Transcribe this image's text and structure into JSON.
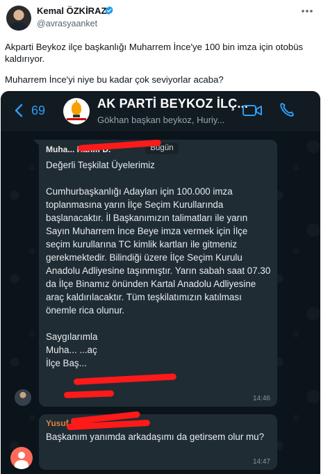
{
  "tweet": {
    "display_name": "Kemal ÖZKİRAZ",
    "handle": "@avrasyaanket",
    "text_line_1": "Akparti Beykoz ilçe başkanlığı Muharrem İnce'ye 100 bin imza için otobüs kaldırıyor.",
    "text_line_2": "Muharrem İnce'yi niye bu kadar çok seviyorlar acaba?",
    "verified_icon": "verified-badge-icon",
    "more_icon": "more-options-icon"
  },
  "whatsapp": {
    "back_count": "69",
    "group_name": "AK PARTİ BEYKOZ İLÇ...",
    "group_members": "Gökhan başkan beykoz, Huriy...",
    "messages": [
      {
        "sender": "Muha... Hanifi D.",
        "day_chip": "Bugün",
        "body": "Değerli Teşkilat Üyelerimiz\n\nCumhurbaşkanlığı Adayları için 100.000 imza toplanmasına yarın İlçe Seçim Kurullarında başlanacaktır. İl Başkanımızın talimatları ile yarın Sayın Muharrem İnce Beye imza vermek için İlçe seçim kurullarına TC kimlik kartları ile gitmeniz gerekmektedir. Bilindiği üzere İlçe Seçim Kurulu Anadolu Adliyesine taşınmıştır. Yarın sabah saat 07.30 da İlçe Binamız önünden Kartal Anadolu Adliyesine araç kaldırılacaktır. Tüm teşkilatımızın katılması önemle rica olunur.\n\nSaygılarımla\nMuha... ...aç\nİlçe Baş...",
        "time": "14:46"
      },
      {
        "sender": "Yusuf İ...",
        "body": "Başkanım yanımda arkadaşımı da getirsem olur mu?",
        "time": "14:47"
      }
    ]
  }
}
